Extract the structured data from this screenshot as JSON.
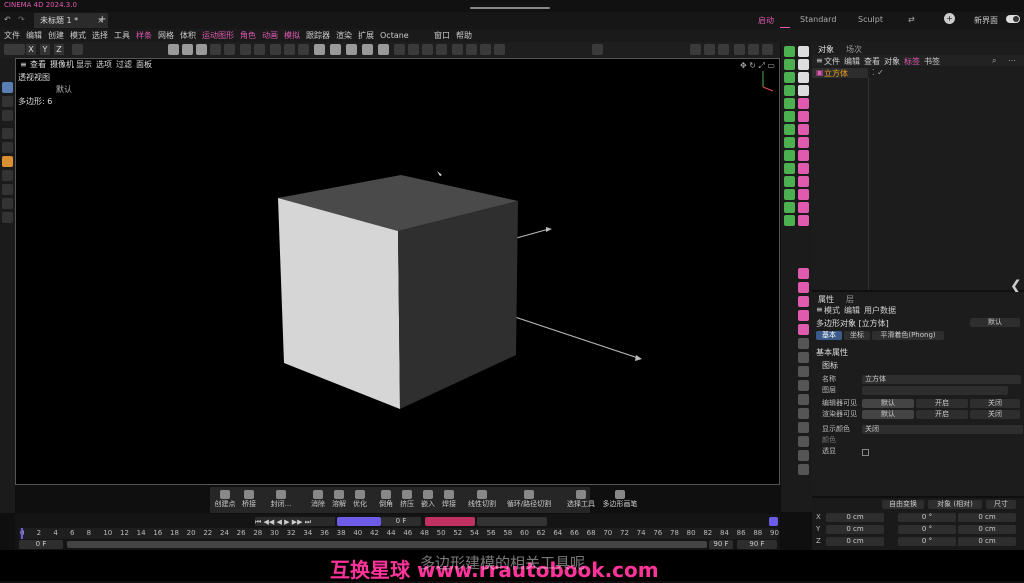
{
  "app": {
    "title_text": "CINEMA 4D 2024.3.0",
    "tab_label": "未标题 1 *",
    "layouts": [
      "启动",
      "Standard",
      "Sculpt"
    ],
    "new_layout_label": "新界面"
  },
  "menubar": [
    "文件",
    "编辑",
    "创建",
    "模式",
    "选择",
    "工具",
    "样条",
    "网格",
    "体积",
    "运动图形",
    "角色",
    "动画",
    "模拟",
    "跟踪器",
    "渲染",
    "扩展",
    "Octane",
    "窗口",
    "帮助"
  ],
  "toolbar": {
    "axes": [
      "X",
      "Y",
      "Z"
    ]
  },
  "viewport": {
    "menu": [
      "查看",
      "摄像机",
      "显示",
      "选项",
      "过滤",
      "面板"
    ],
    "camera_label": "透视视图",
    "view_name": "默认",
    "poly_count": "多边形: 6"
  },
  "object_manager": {
    "tabs": [
      "对象",
      "场次"
    ],
    "menu": [
      "文件",
      "编辑",
      "查看",
      "对象",
      "标签",
      "书签"
    ],
    "object_name": "立方体"
  },
  "attributes": {
    "tabs": [
      "属性",
      "层"
    ],
    "menu": [
      "模式",
      "编辑",
      "用户数据"
    ],
    "object_title": "多边形对象 [立方体]",
    "dropdown": "默认",
    "sub_tabs": [
      "基本",
      "坐标",
      "平滑着色(Phong)"
    ],
    "section": "基本属性",
    "group": "图标",
    "rows": [
      {
        "label": "名称",
        "value": "立方体"
      },
      {
        "label": "图层",
        "value": ""
      }
    ],
    "vis_rows": [
      {
        "label": "编辑器可见",
        "opts": [
          "默认",
          "开启",
          "关闭"
        ]
      },
      {
        "label": "渲染器可见",
        "opts": [
          "默认",
          "开启",
          "关闭"
        ]
      }
    ],
    "color_label": "显示颜色",
    "color_value": "关闭",
    "extra_label": "颜色",
    "xray_label": "透显"
  },
  "coords": {
    "buttons": [
      "自由变换",
      "对象 (相对)",
      "尺寸"
    ],
    "rows": [
      {
        "axis": "X",
        "pos": "0 cm",
        "rot": "0 °",
        "size": "0 cm"
      },
      {
        "axis": "Y",
        "pos": "0 cm",
        "rot": "0 °",
        "size": "0 cm"
      },
      {
        "axis": "Z",
        "pos": "0 cm",
        "rot": "0 °",
        "size": "0 cm"
      }
    ]
  },
  "bottom_toolbar": [
    "创建点",
    "桥接",
    "封闭...",
    "消除",
    "溶解",
    "优化",
    "倒角",
    "挤压",
    "嵌入",
    "焊接",
    "线性切割",
    "循环/路径切割",
    "选择工具",
    "多边形画笔"
  ],
  "timeline": {
    "frame_field": "0 F",
    "start_frame": "0 F",
    "end_frame": "90 F",
    "end_frame2": "90 F",
    "ticks": [
      "0",
      "2",
      "4",
      "6",
      "8",
      "10",
      "12",
      "14",
      "16",
      "18",
      "20",
      "22",
      "24",
      "26",
      "28",
      "30",
      "32",
      "34",
      "36",
      "38",
      "40",
      "42",
      "44",
      "46",
      "48",
      "50",
      "52",
      "54",
      "56",
      "58",
      "60",
      "62",
      "64",
      "66",
      "68",
      "70",
      "72",
      "74",
      "76",
      "78",
      "80",
      "82",
      "84",
      "86",
      "88",
      "90"
    ]
  },
  "subtitle": {
    "watermark": "互换星球 www.rrautobook.com",
    "caption": "多边形建模的相关工具呢"
  },
  "colors": {
    "accent": "#e05ab0",
    "timeline_marker": "#6c5ce7",
    "cube_light": "#d6d6d6",
    "cube_top": "#4a4a4a",
    "cube_dark": "#2f2f2f"
  }
}
